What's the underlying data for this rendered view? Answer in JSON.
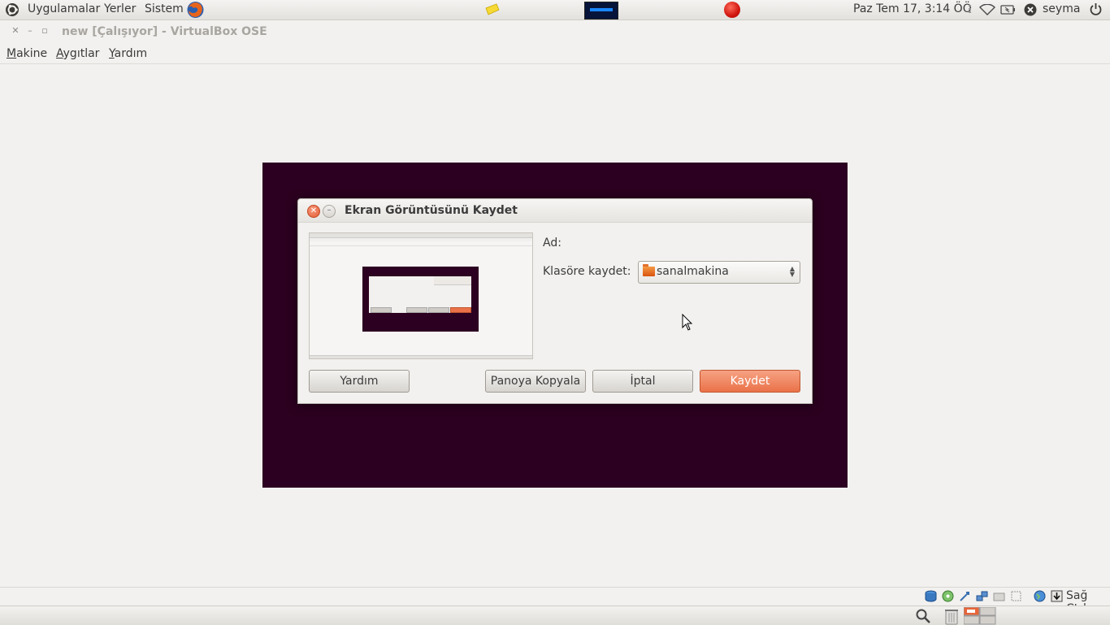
{
  "top_panel": {
    "menu": [
      "Uygulamalar",
      "Yerler",
      "Sistem"
    ],
    "clock": "Paz Tem 17,  3:14 ÖÖ",
    "user": "seyma"
  },
  "window": {
    "title": "new [Çalışıyor] - VirtualBox OSE"
  },
  "menubar": {
    "items": [
      {
        "mnemonic": "M",
        "rest": "akine"
      },
      {
        "mnemonic": "A",
        "rest": "ygıtlar"
      },
      {
        "mnemonic": "Y",
        "rest": "ardım"
      }
    ]
  },
  "dialog": {
    "title": "Ekran Görüntüsünü Kaydet",
    "name_label": "Ad:",
    "folder_label": "Klasöre kaydet:",
    "folder_value": "sanalmakina",
    "buttons": {
      "help": "Yardım",
      "copy": "Panoya Kopyala",
      "cancel": "İptal",
      "save": "Kaydet"
    }
  },
  "statusbar": {
    "host_key": "Sağ Ctrl"
  },
  "colors": {
    "vm_background": "#2c0020",
    "primary_button": "#ea7249"
  }
}
